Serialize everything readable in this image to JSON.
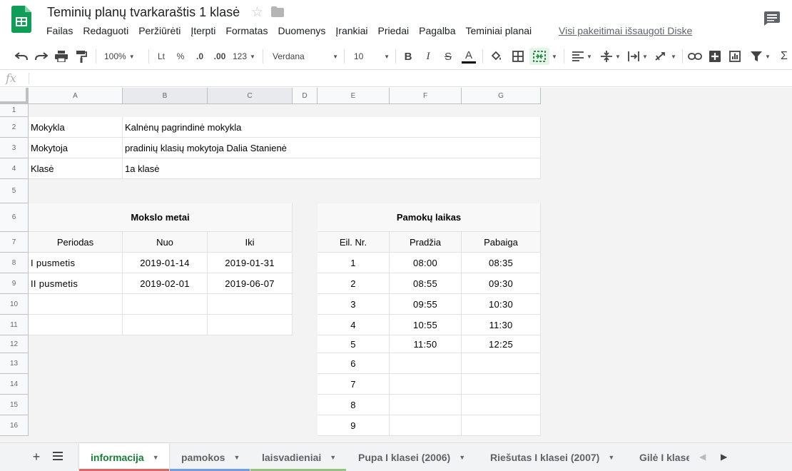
{
  "title": "Teminių planų tvarkaraštis 1 klasė",
  "menu": [
    "Failas",
    "Redaguoti",
    "Peržiūrėti",
    "Įterpti",
    "Formatas",
    "Duomenys",
    "Įrankiai",
    "Priedai",
    "Pagalba",
    "Teminiai planai"
  ],
  "save_status": "Visi pakeitimai išsaugoti Diske",
  "toolbar": {
    "zoom": "100%",
    "currency": "Lt",
    "percent": "%",
    "dec_decrease": ".0",
    "dec_increase": ".00",
    "more_formats": "123",
    "font": "Verdana",
    "font_size": "10",
    "text_color": "#000000"
  },
  "formula_bar": {
    "fx": "fx",
    "value": ""
  },
  "columns": [
    "A",
    "B",
    "C",
    "D",
    "E",
    "F",
    "G"
  ],
  "rows": [
    "1",
    "2",
    "3",
    "4",
    "5",
    "6",
    "7",
    "8",
    "9",
    "10",
    "11",
    "12",
    "13",
    "14",
    "15",
    "16"
  ],
  "info": {
    "school_label": "Mokykla",
    "school_value": "Kalnėnų pagrindinė mokykla",
    "teacher_label": "Mokytoja",
    "teacher_value": "pradinių klasių mokytoja Dalia Stanienė",
    "class_label": "Klasė",
    "class_value": "1a klasė"
  },
  "school_year": {
    "title": "Mokslo metai",
    "headers": [
      "Periodas",
      "Nuo",
      "Iki"
    ],
    "rows": [
      [
        "I pusmetis",
        "2019-01-14",
        "2019-01-31"
      ],
      [
        "II pusmetis",
        "2019-02-01",
        "2019-06-07"
      ],
      [
        "",
        "",
        ""
      ],
      [
        "",
        "",
        ""
      ]
    ]
  },
  "lesson_times": {
    "title": "Pamokų laikas",
    "headers": [
      "Eil. Nr.",
      "Pradžia",
      "Pabaiga"
    ],
    "rows": [
      [
        "1",
        "08:00",
        "08:35"
      ],
      [
        "2",
        "08:55",
        "09:30"
      ],
      [
        "3",
        "09:55",
        "10:30"
      ],
      [
        "4",
        "10:55",
        "11:30"
      ],
      [
        "5",
        "11:50",
        "12:25"
      ],
      [
        "6",
        "",
        ""
      ],
      [
        "7",
        "",
        ""
      ],
      [
        "8",
        "",
        ""
      ],
      [
        "9",
        "",
        ""
      ]
    ]
  },
  "sheets": [
    {
      "label": "informacija",
      "color": "#e06666",
      "active": true
    },
    {
      "label": "pamokos",
      "color": "#6d9eeb",
      "active": false
    },
    {
      "label": "laisvadieniai",
      "color": "#93c47d",
      "active": false
    },
    {
      "label": "Pupa I klasei (2006)",
      "color": "",
      "active": false
    },
    {
      "label": "Riešutas I klasei (2007)",
      "color": "",
      "active": false
    },
    {
      "label": "Gilė I klasei",
      "color": "",
      "active": false
    }
  ],
  "colors": {
    "brand_green": "#0f9d58",
    "active_tab_text": "#188038"
  }
}
